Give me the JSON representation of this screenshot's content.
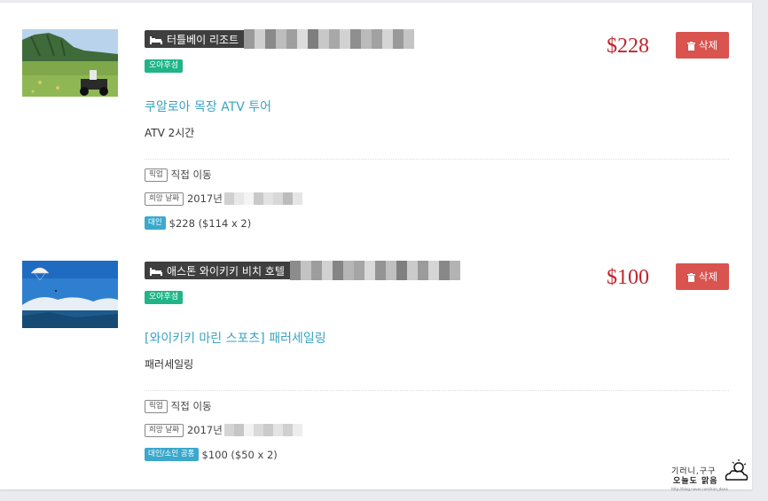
{
  "items": [
    {
      "hotel": "터틀베이 리조트",
      "tag": "오아후섬",
      "title": "쿠알로아 목장 ATV 투어",
      "subtitle": "ATV 2시간",
      "pickup_label": "픽업",
      "pickup_value": "직접 이동",
      "date_label": "희망 날짜",
      "date_value": "2017년",
      "pax_label": "대인",
      "pax_value": "$228 ($114 x 2)",
      "price": "$228",
      "delete_label": "삭제",
      "image_icon": "atv-ranch-photo"
    },
    {
      "hotel": "애스톤 와이키키 비치 호텔",
      "tag": "오아후섬",
      "title": "[와이키키 마린 스포츠] 패러세일링",
      "subtitle": "패러세일링",
      "pickup_label": "픽업",
      "pickup_value": "직접 이동",
      "date_label": "희망 날짜",
      "date_value": "2017년",
      "pax_label": "대인/소인 공통",
      "pax_value": "$100 ($50 x 2)",
      "price": "$100",
      "delete_label": "삭제",
      "image_icon": "parasailing-photo"
    }
  ],
  "watermark": {
    "line1": "기러니,구구",
    "line2": "오늘도 맑음",
    "url": "http://blog.naver.com/kim_dana"
  },
  "colors": {
    "price": "#c0242c",
    "delete_button": "#d9534f",
    "title_link": "#3aa3c2",
    "tag_green": "#20b487",
    "tag_blue": "#3ba8cc",
    "hotel_badge": "#3f3f3f"
  }
}
